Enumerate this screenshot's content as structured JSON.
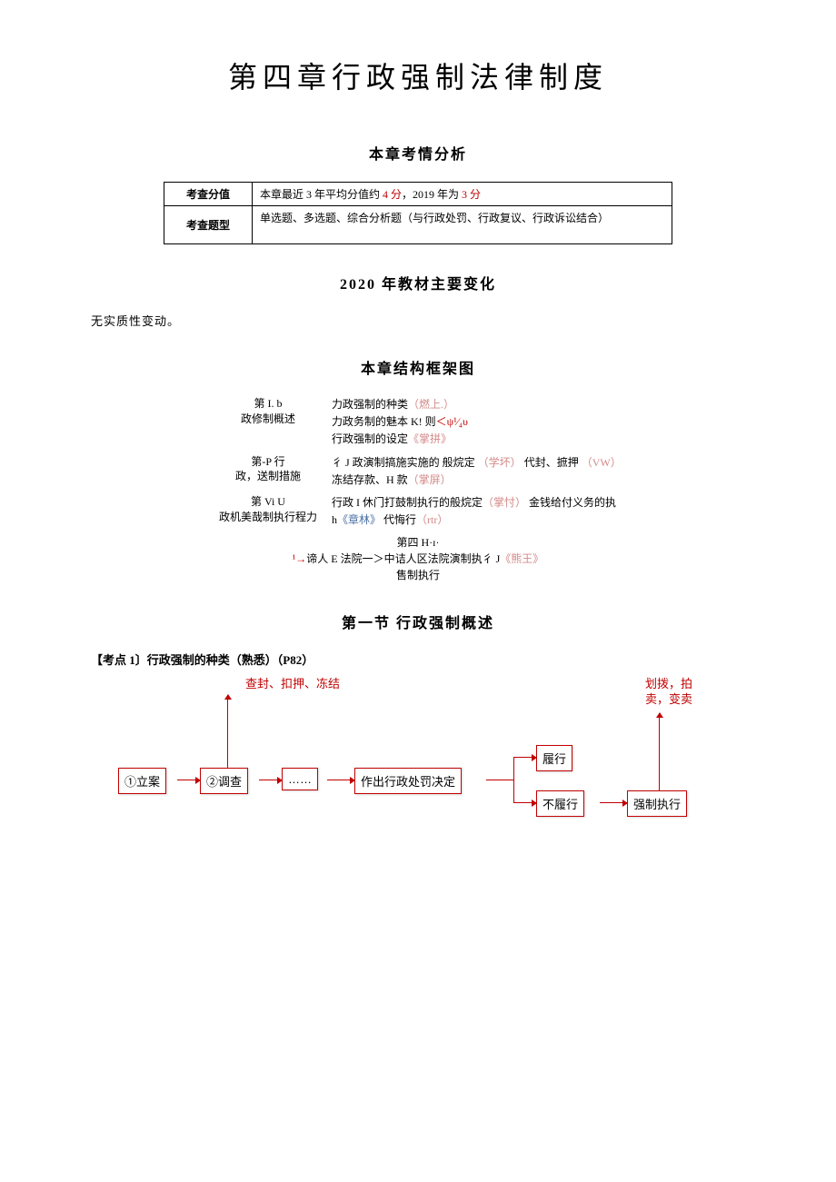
{
  "title": "第四章行政强制法律制度",
  "section_exam": "本章考情分析",
  "exam_table": {
    "row1_label": "考查分值",
    "row1_prefix": "本章最近 3 年平均分值约 ",
    "row1_v1": "4 分",
    "row1_mid": "，2019 年为 ",
    "row1_v2": "3 分",
    "row2_label": "考查题型",
    "row2_value": "单选题、多选题、综合分析题（与行政处罚、行政复议、行政诉讼结合）"
  },
  "section_changes": "2020 年教材主要变化",
  "changes_text": "无实质性变动。",
  "section_structure": "本章结构框架图",
  "outline": {
    "s1_left1": "第 I. b",
    "s1_left2": "政修制概述",
    "s1_r1a": "力政强制的种类",
    "s1_r1b": "（燃上.）",
    "s1_r2a": "力政务制的魅本 K! 则",
    "s1_r2b": "＜ψ¹⁄₄υ",
    "s1_r3a": "行政强制的设定",
    "s1_r3b": "《掌拼》",
    "s2_left1": "第-P 行",
    "s2_left2": "政，送制措施",
    "s2_r1a": "彳 J 政演制搞施实施的 般烷定",
    "s2_r1b": "（学坏）",
    "s2_r1c": "  代封、摭押",
    "s2_r1d": "（VW）",
    "s2_r2a": "冻结存款、H 款",
    "s2_r2b": "（掌屏）",
    "s3_left1": "第 Vi  U",
    "s3_left2": "政机美哉制执行程力",
    "s3_r1a": "行政 I 休门打鼓制执行的般烷定",
    "s3_r1b": "（掌忖）",
    "s3_r1c": "  金钱给付义务的执 h",
    "s3_r1d": "《章林》",
    "s3_r1e": "  代悔行",
    "s3_r1f": "（rtr）",
    "s4_l1": "第四 H·ɪ·",
    "s4_l2a": "¹→",
    "s4_l2b": "谛人 E 法院一＞中诘人区法院演制执彳 J",
    "s4_l2c": "《熊王》",
    "s4_l3": "售制执行"
  },
  "section_first": "第一节 行政强制概述",
  "point1": "【考点 1〕行政强制的种类（熟悉）（P82）",
  "flow": {
    "top_label": "查封、扣押、冻结",
    "right_label1": "划拨，拍",
    "right_label2": "卖，变卖",
    "b1": "①立案",
    "b2": "②调查",
    "b3": "……",
    "b4": "作出行政处罚决定",
    "b5": "履行",
    "b6": "不履行",
    "b7": "强制执行"
  }
}
